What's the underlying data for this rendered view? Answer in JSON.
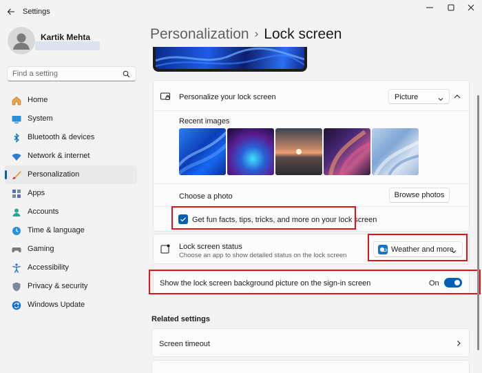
{
  "window": {
    "title": "Settings"
  },
  "profile": {
    "name": "Kartik Mehta"
  },
  "search": {
    "placeholder": "Find a setting"
  },
  "nav": [
    {
      "label": "Home",
      "icon": "home-icon",
      "active": false
    },
    {
      "label": "System",
      "icon": "system-icon",
      "active": false
    },
    {
      "label": "Bluetooth & devices",
      "icon": "bluetooth-icon",
      "active": false
    },
    {
      "label": "Network & internet",
      "icon": "network-icon",
      "active": false
    },
    {
      "label": "Personalization",
      "icon": "personalization-icon",
      "active": true
    },
    {
      "label": "Apps",
      "icon": "apps-icon",
      "active": false
    },
    {
      "label": "Accounts",
      "icon": "accounts-icon",
      "active": false
    },
    {
      "label": "Time & language",
      "icon": "time-language-icon",
      "active": false
    },
    {
      "label": "Gaming",
      "icon": "gaming-icon",
      "active": false
    },
    {
      "label": "Accessibility",
      "icon": "accessibility-icon",
      "active": false
    },
    {
      "label": "Privacy & security",
      "icon": "privacy-icon",
      "active": false
    },
    {
      "label": "Windows Update",
      "icon": "update-icon",
      "active": false
    }
  ],
  "breadcrumb": {
    "parent": "Personalization",
    "separator": "›",
    "current": "Lock screen"
  },
  "personalize": {
    "label": "Personalize your lock screen",
    "value": "Picture",
    "recent_images_label": "Recent images",
    "choose_photo_label": "Choose a photo",
    "browse_label": "Browse photos",
    "fun_facts_label": "Get fun facts, tips, tricks, and more on your lock screen",
    "fun_facts_checked": true
  },
  "status": {
    "label": "Lock screen status",
    "description": "Choose an app to show detailed status on the lock screen",
    "value": "Weather and more"
  },
  "signin": {
    "label": "Show the lock screen background picture on the sign-in screen",
    "state_label": "On",
    "on": true
  },
  "related": {
    "heading": "Related settings",
    "screen_timeout": "Screen timeout"
  },
  "colors": {
    "accent": "#005fb8",
    "highlight": "#e3101a"
  }
}
